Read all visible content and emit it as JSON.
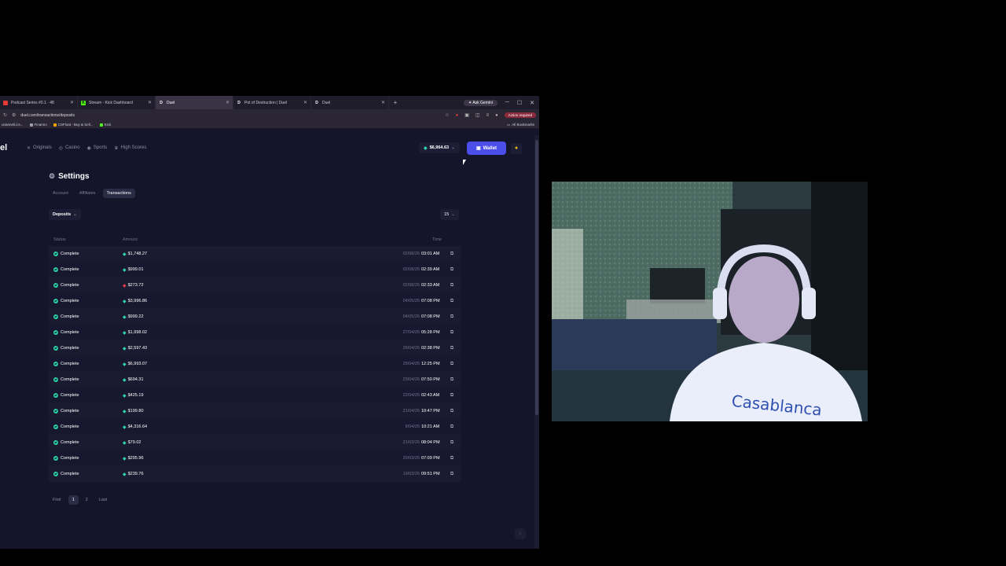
{
  "browser": {
    "tabs": [
      {
        "title": "Podcast Series #0.1 · 48",
        "fav_color": "#e53935",
        "fav_letter": ""
      },
      {
        "title": "Stream - Kick Dashboard",
        "fav_color": "#53fc18",
        "fav_letter": "K"
      },
      {
        "title": "Duel",
        "fav_color": "#ffffff",
        "fav_letter": "D",
        "active": true
      },
      {
        "title": "Pot of Destruction | Duel",
        "fav_color": "#ffffff",
        "fav_letter": "D"
      },
      {
        "title": "Duel",
        "fav_color": "#ffffff",
        "fav_letter": "D"
      }
    ],
    "new_tab": "+",
    "gemini_label": "Ask Gemini",
    "url": "duel.com/transactions/deposits",
    "action_required": "Action required",
    "bookmarks": [
      {
        "label": "unanneli.ics...",
        "color": "#6b6b7a"
      },
      {
        "label": "Finanno",
        "color": "#9aa0a6"
      },
      {
        "label": "CSFloat - Buy & Sell...",
        "color": "#f0a500"
      },
      {
        "label": "Kick",
        "color": "#53fc18"
      }
    ],
    "all_bookmarks": "All Bookmarks"
  },
  "site": {
    "logo": "el",
    "nav": [
      {
        "label": "Originals",
        "icon": "x-icon"
      },
      {
        "label": "Casino",
        "icon": "casino-icon"
      },
      {
        "label": "Sports",
        "icon": "sports-icon"
      },
      {
        "label": "High Scores",
        "icon": "trophy-icon"
      }
    ],
    "balance": "$6,964.63",
    "wallet_label": "Wallet",
    "settings_title": "Settings",
    "settings_tabs": [
      "Account",
      "Affiliates",
      "Transactions"
    ],
    "active_tab": "Transactions",
    "filter_label": "Deposits",
    "per_page": "15",
    "table": {
      "headers": {
        "status": "Status",
        "amount": "Amount",
        "time": "Time"
      },
      "rows": [
        {
          "status": "Complete",
          "coin": "green",
          "amount": "$1,748.27",
          "date": "02/08/26",
          "time": "03:01 AM"
        },
        {
          "status": "Complete",
          "coin": "green",
          "amount": "$999.01",
          "date": "02/08/26",
          "time": "02:39 AM"
        },
        {
          "status": "Complete",
          "coin": "red",
          "amount": "$273.72",
          "date": "02/08/26",
          "time": "02:33 AM"
        },
        {
          "status": "Complete",
          "coin": "green",
          "amount": "$3,996.86",
          "date": "04/05/26",
          "time": "07:08 PM"
        },
        {
          "status": "Complete",
          "coin": "green",
          "amount": "$999.22",
          "date": "04/05/26",
          "time": "07:08 PM"
        },
        {
          "status": "Complete",
          "coin": "green",
          "amount": "$1,998.02",
          "date": "27/04/26",
          "time": "05:28 PM"
        },
        {
          "status": "Complete",
          "coin": "green",
          "amount": "$2,597.43",
          "date": "26/04/26",
          "time": "02:38 PM"
        },
        {
          "status": "Complete",
          "coin": "green",
          "amount": "$6,993.07",
          "date": "25/04/26",
          "time": "12:25 PM"
        },
        {
          "status": "Complete",
          "coin": "green",
          "amount": "$694.31",
          "date": "23/04/26",
          "time": "07:50 PM"
        },
        {
          "status": "Complete",
          "coin": "green",
          "amount": "$425.19",
          "date": "22/04/26",
          "time": "02:43 AM"
        },
        {
          "status": "Complete",
          "coin": "green",
          "amount": "$199.80",
          "date": "21/04/26",
          "time": "10:47 PM"
        },
        {
          "status": "Complete",
          "coin": "green",
          "amount": "$4,316.64",
          "date": "8/04/26",
          "time": "10:21 AM"
        },
        {
          "status": "Complete",
          "coin": "green",
          "amount": "$79.02",
          "date": "21/03/26",
          "time": "08:04 PM"
        },
        {
          "status": "Complete",
          "coin": "green",
          "amount": "$295.96",
          "date": "20/03/26",
          "time": "07:09 PM"
        },
        {
          "status": "Complete",
          "coin": "green",
          "amount": "$239.76",
          "date": "19/03/26",
          "time": "09:51 PM"
        }
      ]
    },
    "pagination": {
      "first": "First",
      "pages": [
        "1",
        "2"
      ],
      "current": "1",
      "last": "Last"
    }
  },
  "webcam": {
    "shirt_text": "Casablanca"
  },
  "colors": {
    "bg": "#14152a",
    "accent": "#4b4ee8",
    "success": "#2dd4a8"
  }
}
